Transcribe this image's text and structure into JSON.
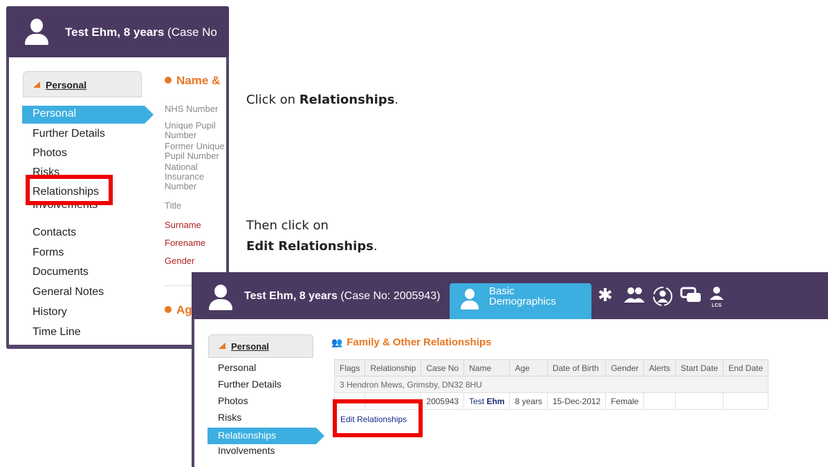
{
  "panel1": {
    "header_name": "Test Ehm, 8 years",
    "header_case": " (Case No",
    "sidebar_heading": "Personal",
    "nav": [
      "Personal",
      "Further Details",
      "Photos",
      "Risks",
      "Relationships",
      "Involvements",
      "Contacts",
      "Forms",
      "Documents",
      "General Notes",
      "History",
      "Time Line"
    ],
    "section_name": "Name &",
    "section_age": "Ag",
    "fields": {
      "nhs": "NHS Number",
      "upn": "Unique Pupil\nNumber",
      "former_upn": "Former Unique\nPupil Number",
      "ni": "National\nInsurance\nNumber",
      "title": "Title",
      "surname": "Surname",
      "forename": "Forename",
      "gender": "Gender"
    }
  },
  "instructions": {
    "step1_pre": "Click on ",
    "step1_bold": "Relationships",
    "step1_post": ".",
    "step2_line1": "Then click on",
    "step2_bold": "Edit Relationships",
    "step2_post": "."
  },
  "panel2": {
    "header_name": "Test Ehm, 8 years",
    "header_case": " (Case No: 2005943)",
    "tab_line1": "Basic",
    "tab_line2": "Demographics",
    "header_icons": [
      "gear-icon",
      "people-icon",
      "user-circle-icon",
      "messages-icon",
      "lcs-user-icon"
    ],
    "sidebar_heading": "Personal",
    "nav": [
      "Personal",
      "Further Details",
      "Photos",
      "Risks",
      "Relationships",
      "Involvements"
    ],
    "section_title": "Family & Other Relationships",
    "table": {
      "columns": [
        "Flags",
        "Relationship",
        "Case No",
        "Name",
        "Age",
        "Date of Birth",
        "Gender",
        "Alerts",
        "Start Date",
        "End Date"
      ],
      "address": "3 Hendron Mews, Grimsby, DN32 8HU",
      "row": {
        "flags": "",
        "relationship": "",
        "case_no": "2005943",
        "forename": "Test",
        "surname": "Ehm",
        "age": "8 years",
        "dob": "15-Dec-2012",
        "gender": "Female",
        "alerts": "",
        "start_date": "",
        "end_date": ""
      }
    },
    "edit_link": "Edit Relationships"
  },
  "colors": {
    "header_purple": "#4a3a62",
    "accent_blue": "#3daee0",
    "accent_orange": "#e87722",
    "highlight_red": "#ee0000"
  }
}
